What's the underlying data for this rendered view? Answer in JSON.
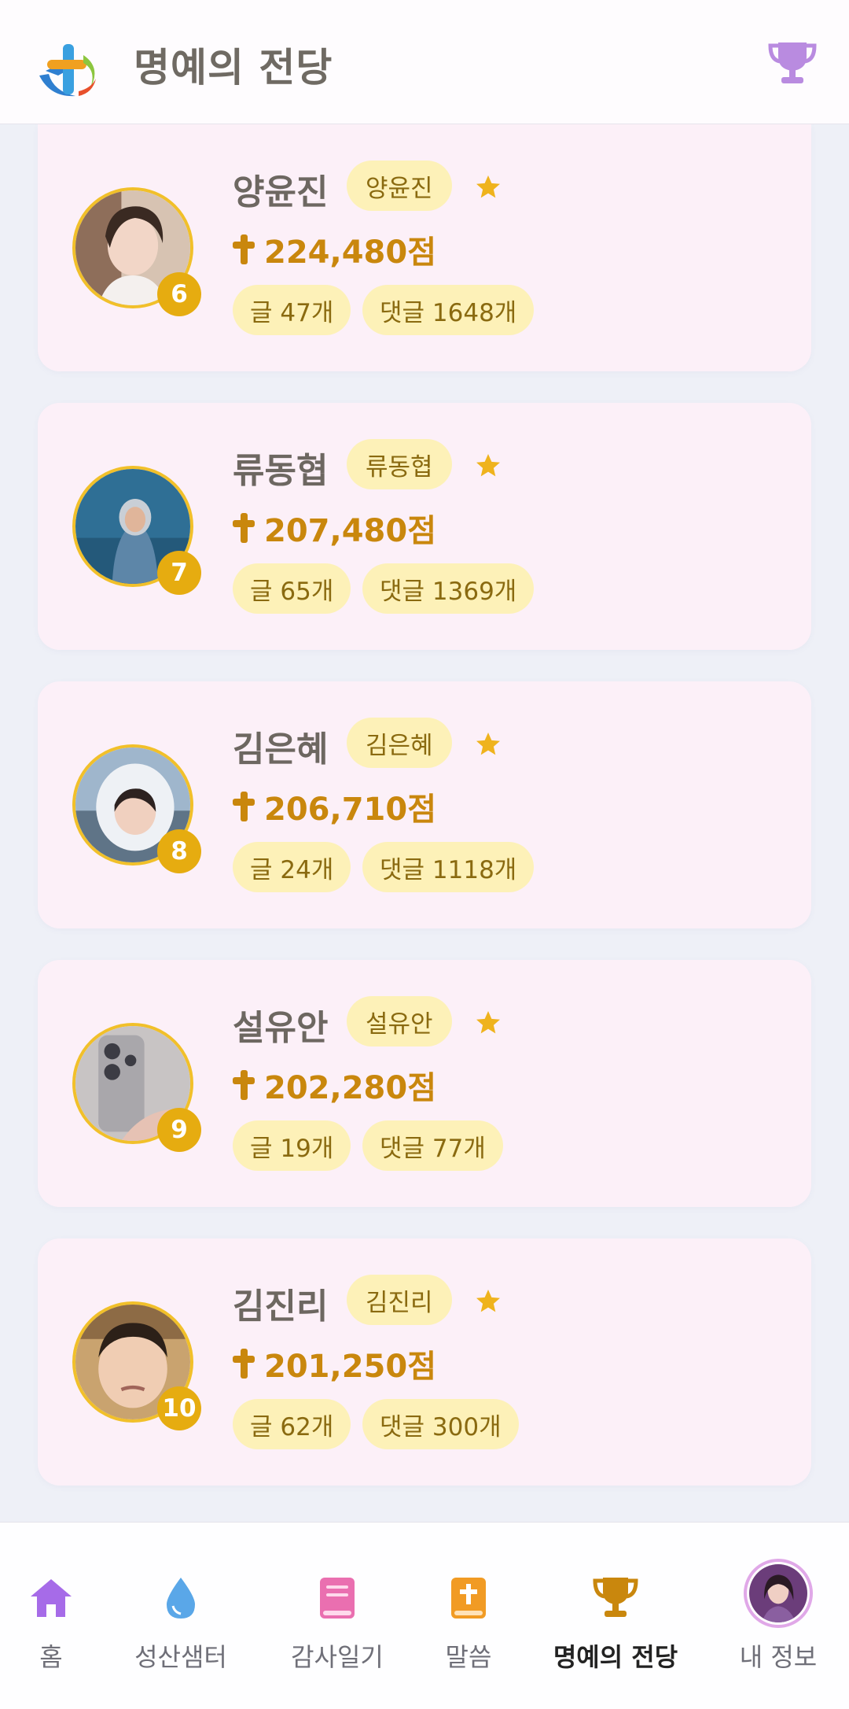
{
  "header": {
    "title": "명예의 전당"
  },
  "rankings": [
    {
      "rank": "6",
      "name": "양윤진",
      "nickname": "양윤진",
      "score": "224,480점",
      "posts": "글 47개",
      "comments": "댓글 1648개"
    },
    {
      "rank": "7",
      "name": "류동협",
      "nickname": "류동협",
      "score": "207,480점",
      "posts": "글 65개",
      "comments": "댓글 1369개"
    },
    {
      "rank": "8",
      "name": "김은혜",
      "nickname": "김은혜",
      "score": "206,710점",
      "posts": "글 24개",
      "comments": "댓글 1118개"
    },
    {
      "rank": "9",
      "name": "설유안",
      "nickname": "설유안",
      "score": "202,280점",
      "posts": "글 19개",
      "comments": "댓글 77개"
    },
    {
      "rank": "10",
      "name": "김진리",
      "nickname": "김진리",
      "score": "201,250점",
      "posts": "글 62개",
      "comments": "댓글 300개"
    }
  ],
  "nav": {
    "home": "홈",
    "sanctification": "성산샘터",
    "gratitude": "감사일기",
    "word": "말씀",
    "hall_of_fame": "명예의 전당",
    "my_info": "내 정보"
  },
  "colors": {
    "accent": "#c9870d",
    "rank_badge": "#e6ac10",
    "chip_bg": "#fdf1b8",
    "card_bg": "#fcf0f8",
    "trophy_active": "#c9870d",
    "trophy_header": "#b98be0"
  },
  "icons": {
    "header_logo": "cross-logo-icon",
    "header_right": "trophy-icon",
    "card_star": "star-icon",
    "card_score": "cross-icon"
  }
}
